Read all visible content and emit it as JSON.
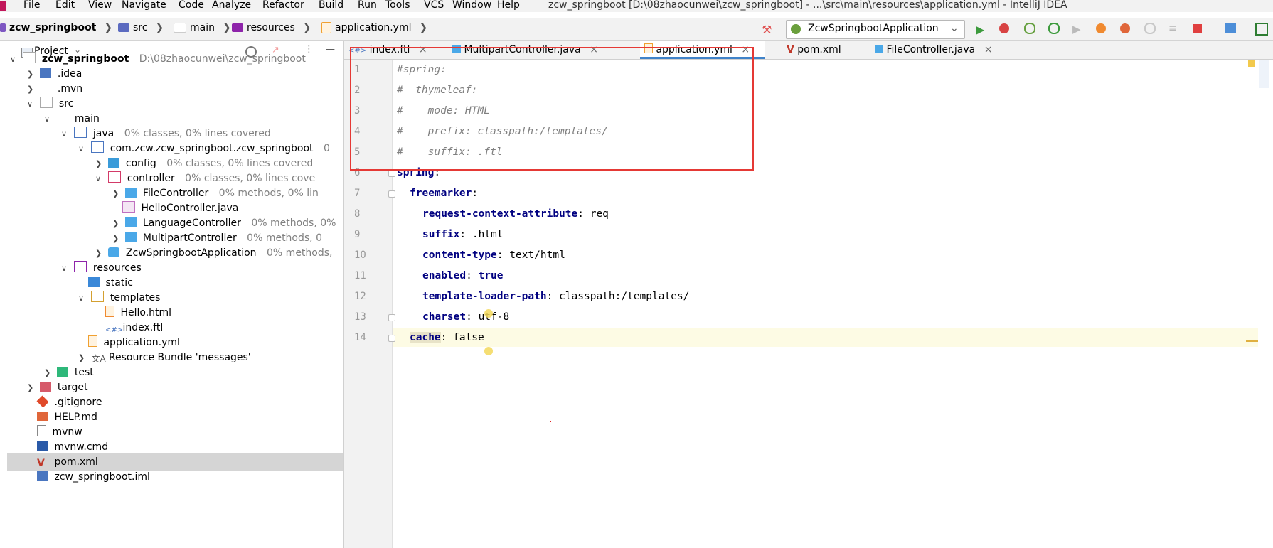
{
  "menu": {
    "items": [
      "File",
      "Edit",
      "View",
      "Navigate",
      "Code",
      "Analyze",
      "Refactor",
      "Build",
      "Run",
      "Tools",
      "VCS",
      "Window",
      "Help"
    ],
    "window_title": "zcw_springboot [D:\\08zhaocunwei\\zcw_springboot] - ...\\src\\main\\resources\\application.yml - IntelliJ IDEA"
  },
  "navbar": {
    "breadcrumbs": [
      "zcw_springboot",
      "src",
      "main",
      "resources",
      "application.yml"
    ],
    "run_config": "ZcwSpringbootApplication"
  },
  "project": {
    "header_label": "Project",
    "rows": [
      {
        "label": "zcw_springboot",
        "sub": "D:\\08zhaocunwei\\zcw_springboot",
        "bold": true
      },
      {
        "label": ".idea",
        "sub": ""
      },
      {
        "label": ".mvn",
        "sub": ""
      },
      {
        "label": "src",
        "sub": ""
      },
      {
        "label": "main",
        "sub": ""
      },
      {
        "label": "java",
        "sub": "0% classes, 0% lines covered"
      },
      {
        "label": "com.zcw.zcw_springboot.zcw_springboot",
        "sub": "0"
      },
      {
        "label": "config",
        "sub": "0% classes, 0% lines covered"
      },
      {
        "label": "controller",
        "sub": "0% classes, 0% lines cove"
      },
      {
        "label": "FileController",
        "sub": "0% methods, 0% lin"
      },
      {
        "label": "HelloController.java",
        "sub": ""
      },
      {
        "label": "LanguageController",
        "sub": "0% methods, 0%"
      },
      {
        "label": "MultipartController",
        "sub": "0% methods, 0"
      },
      {
        "label": "ZcwSpringbootApplication",
        "sub": "0% methods,"
      },
      {
        "label": "resources",
        "sub": ""
      },
      {
        "label": "static",
        "sub": ""
      },
      {
        "label": "templates",
        "sub": ""
      },
      {
        "label": "Hello.html",
        "sub": ""
      },
      {
        "label": "index.ftl",
        "sub": ""
      },
      {
        "label": "application.yml",
        "sub": ""
      },
      {
        "label": "Resource Bundle 'messages'",
        "sub": ""
      },
      {
        "label": "test",
        "sub": ""
      },
      {
        "label": "target",
        "sub": ""
      },
      {
        "label": ".gitignore",
        "sub": ""
      },
      {
        "label": "HELP.md",
        "sub": ""
      },
      {
        "label": "mvnw",
        "sub": ""
      },
      {
        "label": "mvnw.cmd",
        "sub": ""
      },
      {
        "label": "pom.xml",
        "sub": ""
      },
      {
        "label": "zcw_springboot.iml",
        "sub": ""
      }
    ]
  },
  "tabs": [
    "index.ftl",
    "MultipartController.java",
    "application.yml",
    "pom.xml",
    "FileController.java"
  ],
  "editor": {
    "line_numbers": [
      "1",
      "2",
      "3",
      "4",
      "5",
      "6",
      "7",
      "8",
      "9",
      "10",
      "11",
      "12",
      "13",
      "14"
    ],
    "lines": [
      {
        "text": "#spring:"
      },
      {
        "text": "#  thymeleaf:"
      },
      {
        "text": "#    mode: HTML"
      },
      {
        "text": "#    prefix: classpath:/templates/"
      },
      {
        "text": "#    suffix: .ftl"
      },
      {
        "key": "spring",
        "value": ""
      },
      {
        "key": "freemarker",
        "value": ""
      },
      {
        "key": "request-context-attribute",
        "value": " req"
      },
      {
        "key": "suffix",
        "value": " .html"
      },
      {
        "key": "content-type",
        "value": " text/html"
      },
      {
        "key": "enabled",
        "value": " true"
      },
      {
        "key": "template-loader-path",
        "value": " classpath:/templates/"
      },
      {
        "key": "charset",
        "value": " utf-8"
      },
      {
        "key": "cache",
        "value": " false"
      }
    ]
  },
  "colors": {
    "accent": "#4083c9",
    "highlight_box": "#e53935",
    "comment": "#808080",
    "key": "#000080"
  }
}
